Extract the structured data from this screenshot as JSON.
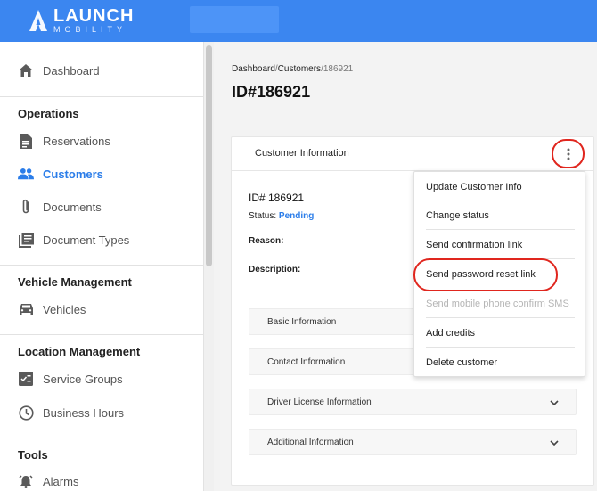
{
  "header": {
    "logo_main": "LAUNCH",
    "logo_sub": "MOBILITY",
    "accent": "#3b86f0"
  },
  "sidebar": {
    "dashboard": "Dashboard",
    "operations_title": "Operations",
    "reservations": "Reservations",
    "customers": "Customers",
    "documents": "Documents",
    "document_types": "Document Types",
    "vehicle_title": "Vehicle Management",
    "vehicles": "Vehicles",
    "location_title": "Location Management",
    "service_groups": "Service Groups",
    "business_hours": "Business Hours",
    "tools_title": "Tools",
    "alarms": "Alarms"
  },
  "breadcrumb": {
    "dashboard": "Dashboard",
    "sep1": "/",
    "customers": "Customers",
    "sep2": "/",
    "current": "186921"
  },
  "page": {
    "title": "ID#186921"
  },
  "card": {
    "title": "Customer Information",
    "id_line": "ID# 186921",
    "status_label": "Status:",
    "status_value": "Pending",
    "status_color": "#2b7de9",
    "reason_label": "Reason:",
    "description_label": "Description:",
    "sections": {
      "basic": "Basic Information",
      "contact": "Contact Information",
      "driver": "Driver License Information",
      "additional": "Additional Information"
    }
  },
  "menu": {
    "update": "Update Customer Info",
    "change_status": "Change status",
    "send_confirmation": "Send confirmation link",
    "send_password": "Send password reset link",
    "send_sms": "Send mobile phone confirm SMS",
    "add_credits": "Add credits",
    "delete": "Delete customer"
  }
}
